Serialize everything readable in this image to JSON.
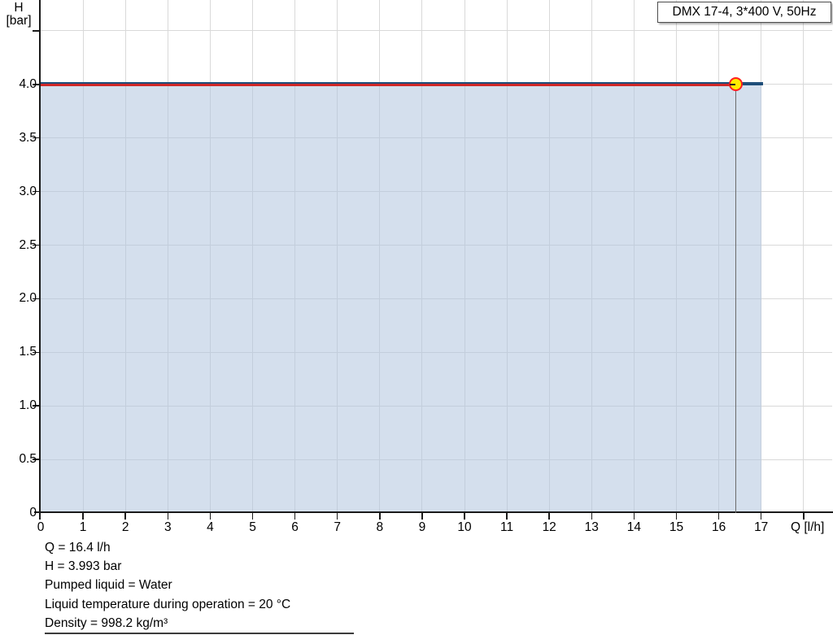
{
  "legend": {
    "label": "DMX 17-4, 3*400 V, 50Hz"
  },
  "chart_data": {
    "type": "area",
    "title": "DMX 17-4, 3*400 V, 50Hz",
    "grid": true,
    "xlim": [
      0,
      18.7
    ],
    "ylim": [
      0,
      4.79
    ],
    "x_axis": {
      "label": "Q [l/h]",
      "tick_values": [
        0,
        1,
        2,
        3,
        4,
        5,
        6,
        7,
        8,
        9,
        10,
        11,
        12,
        13,
        14,
        15,
        16,
        17
      ],
      "tick_labels": [
        "0",
        "1",
        "2",
        "3",
        "4",
        "5",
        "6",
        "7",
        "8",
        "9",
        "10",
        "11",
        "12",
        "13",
        "14",
        "15",
        "16",
        "17"
      ],
      "grid_values": [
        1,
        2,
        3,
        4,
        5,
        6,
        7,
        8,
        9,
        10,
        11,
        12,
        13,
        14,
        15,
        16,
        17,
        18
      ],
      "minor_tick_values": [
        18
      ]
    },
    "y_axis": {
      "label": "H [bar]",
      "title_line1": "H",
      "title_line2": "[bar]",
      "tick_values": [
        0,
        0.5,
        1.0,
        1.5,
        2.0,
        2.5,
        3.0,
        3.5,
        4.0
      ],
      "tick_labels": [
        "0",
        "0.5",
        "1.0",
        "1.5",
        "2.0",
        "2.5",
        "3.0",
        "3.5",
        "4.0"
      ],
      "grid_values": [
        0.5,
        1.0,
        1.5,
        2.0,
        2.5,
        3.0,
        3.5,
        4.0,
        4.5
      ],
      "minor_tick_values": [
        4.5
      ]
    },
    "series": [
      {
        "name": "pump-curve",
        "color": "#1f4e79",
        "x": [
          0,
          17
        ],
        "y": [
          4.0,
          4.0
        ]
      },
      {
        "name": "operating-segment",
        "color": "#d02828",
        "x": [
          0,
          16.4
        ],
        "y": [
          3.993,
          3.993
        ]
      }
    ],
    "area_fill": {
      "color": "#b0c4de",
      "opacity": 0.55,
      "x_from": 0,
      "x_to": 17,
      "y_top": 4.0
    },
    "operating_point": {
      "q": 16.4,
      "h": 3.993,
      "marker_fill": "#ffeb00",
      "marker_ring": "#ff2020",
      "dropline_color": "#6b6b6b"
    }
  },
  "operating_conditions": {
    "lines": [
      "Q = 16.4 l/h",
      "H = 3.993 bar",
      "Pumped liquid = Water",
      "Liquid temperature during operation = 20 °C",
      "Density = 998.2 kg/m³"
    ]
  }
}
